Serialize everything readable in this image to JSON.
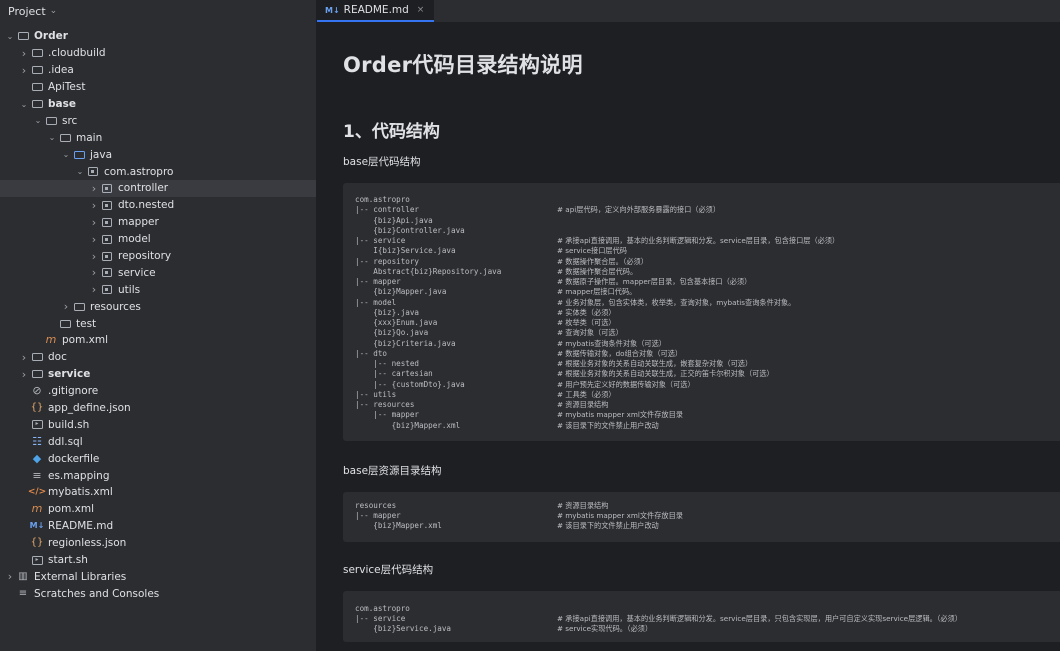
{
  "project_pane": {
    "title": "Project"
  },
  "tree": [
    {
      "label": "Order",
      "depth": 0,
      "arrow": "open",
      "icon": "folder-module",
      "bold": true
    },
    {
      "label": ".cloudbuild",
      "depth": 1,
      "arrow": "closed",
      "icon": "folder"
    },
    {
      "label": ".idea",
      "depth": 1,
      "arrow": "closed",
      "icon": "folder"
    },
    {
      "label": "ApiTest",
      "depth": 1,
      "arrow": "none",
      "icon": "folder"
    },
    {
      "label": "base",
      "depth": 1,
      "arrow": "open",
      "icon": "folder-module",
      "bold": true
    },
    {
      "label": "src",
      "depth": 2,
      "arrow": "open",
      "icon": "folder"
    },
    {
      "label": "main",
      "depth": 3,
      "arrow": "open",
      "icon": "folder"
    },
    {
      "label": "java",
      "depth": 4,
      "arrow": "open",
      "icon": "folder-blue"
    },
    {
      "label": "com.astropro",
      "depth": 5,
      "arrow": "open",
      "icon": "package"
    },
    {
      "label": "controller",
      "depth": 6,
      "arrow": "closed",
      "icon": "package",
      "selected": true
    },
    {
      "label": "dto.nested",
      "depth": 6,
      "arrow": "closed",
      "icon": "package"
    },
    {
      "label": "mapper",
      "depth": 6,
      "arrow": "closed",
      "icon": "package"
    },
    {
      "label": "model",
      "depth": 6,
      "arrow": "closed",
      "icon": "package"
    },
    {
      "label": "repository",
      "depth": 6,
      "arrow": "closed",
      "icon": "package"
    },
    {
      "label": "service",
      "depth": 6,
      "arrow": "closed",
      "icon": "package"
    },
    {
      "label": "utils",
      "depth": 6,
      "arrow": "closed",
      "icon": "package"
    },
    {
      "label": "resources",
      "depth": 4,
      "arrow": "closed",
      "icon": "folder-resources"
    },
    {
      "label": "test",
      "depth": 3,
      "arrow": "none",
      "icon": "folder"
    },
    {
      "label": "pom.xml",
      "depth": 2,
      "arrow": "none",
      "icon": "maven"
    },
    {
      "label": "doc",
      "depth": 1,
      "arrow": "closed",
      "icon": "folder"
    },
    {
      "label": "service",
      "depth": 1,
      "arrow": "closed",
      "icon": "folder-module",
      "bold": true
    },
    {
      "label": ".gitignore",
      "depth": 1,
      "arrow": "none",
      "icon": "gitignore"
    },
    {
      "label": "app_define.json",
      "depth": 1,
      "arrow": "none",
      "icon": "json"
    },
    {
      "label": "build.sh",
      "depth": 1,
      "arrow": "none",
      "icon": "shell"
    },
    {
      "label": "ddl.sql",
      "depth": 1,
      "arrow": "none",
      "icon": "sql"
    },
    {
      "label": "dockerfile",
      "depth": 1,
      "arrow": "none",
      "icon": "docker"
    },
    {
      "label": "es.mapping",
      "depth": 1,
      "arrow": "none",
      "icon": "text"
    },
    {
      "label": "mybatis.xml",
      "depth": 1,
      "arrow": "none",
      "icon": "xml"
    },
    {
      "label": "pom.xml",
      "depth": 1,
      "arrow": "none",
      "icon": "maven"
    },
    {
      "label": "README.md",
      "depth": 1,
      "arrow": "none",
      "icon": "markdown"
    },
    {
      "label": "regionless.json",
      "depth": 1,
      "arrow": "none",
      "icon": "json"
    },
    {
      "label": "start.sh",
      "depth": 1,
      "arrow": "none",
      "icon": "shell"
    },
    {
      "label": "External Libraries",
      "depth": 0,
      "arrow": "closed",
      "icon": "libraries"
    },
    {
      "label": "Scratches and Consoles",
      "depth": 0,
      "arrow": "none",
      "icon": "scratches"
    }
  ],
  "editor": {
    "tab": {
      "badge": "M↓",
      "label": "README.md",
      "close": "×"
    },
    "h1": "Order代码目录结构说明",
    "h2": "1、代码结构",
    "sections": [
      {
        "caption": "base层代码结构",
        "lines": [
          {
            "code": "com.astropro",
            "comment": ""
          },
          {
            "code": "|-- controller",
            "comment": "# api层代码，定义向外部服务暴露的接口（必须）"
          },
          {
            "code": "    {biz}Api.java",
            "comment": ""
          },
          {
            "code": "    {biz}Controller.java",
            "comment": ""
          },
          {
            "code": "|-- service",
            "comment": "# 承接api直接调用，基本的业务判断逻辑和分发。service层目录，包含接口层（必须）"
          },
          {
            "code": "    I{biz}Service.java",
            "comment": "# service接口层代码"
          },
          {
            "code": "|-- repository",
            "comment": "# 数据操作聚合层。（必须）"
          },
          {
            "code": "    Abstract{biz}Repository.java",
            "comment": "# 数据操作聚合层代码。"
          },
          {
            "code": "|-- mapper",
            "comment": "# 数据原子操作层。mapper层目录，包含基本接口（必须）"
          },
          {
            "code": "    {biz}Mapper.java",
            "comment": "# mapper层接口代码。"
          },
          {
            "code": "|-- model",
            "comment": "# 业务对象层，包含实体类，枚举类，查询对象，mybatis查询条件对象。"
          },
          {
            "code": "    {biz}.java",
            "comment": "# 实体类（必须）"
          },
          {
            "code": "    {xxx}Enum.java",
            "comment": "# 枚举类（可选）"
          },
          {
            "code": "    {biz}Qo.java",
            "comment": "# 查询对象（可选）"
          },
          {
            "code": "    {biz}Criteria.java",
            "comment": "# mybatis查询条件对象（可选）"
          },
          {
            "code": "|-- dto",
            "comment": "# 数据传输对象，do组合对象（可选）"
          },
          {
            "code": "    |-- nested",
            "comment": "# 根据业务对象的关系自动关联生成，嵌套复杂对象（可选）"
          },
          {
            "code": "    |-- cartesian",
            "comment": "# 根据业务对象的关系自动关联生成，正交的笛卡尔积对象（可选）"
          },
          {
            "code": "    |-- {customDto}.java",
            "comment": "# 用户预先定义好的数据传输对象（可选）"
          },
          {
            "code": "|-- utils",
            "comment": "# 工具类（必须）"
          },
          {
            "code": "|-- resources",
            "comment": "# 资源目录结构"
          },
          {
            "code": "    |-- mapper",
            "comment": "# mybatis mapper xml文件存放目录"
          },
          {
            "code": "        {biz}Mapper.xml",
            "comment": "# 该目录下的文件禁止用户改动"
          }
        ]
      },
      {
        "caption": "base层资源目录结构",
        "lines": [
          {
            "code": "resources",
            "comment": "# 资源目录结构"
          },
          {
            "code": "|-- mapper",
            "comment": "# mybatis mapper xml文件存放目录"
          },
          {
            "code": "    {biz}Mapper.xml",
            "comment": "# 该目录下的文件禁止用户改动"
          }
        ]
      },
      {
        "caption": "service层代码结构",
        "lines": [
          {
            "code": "com.astropro",
            "comment": ""
          },
          {
            "code": "|-- service",
            "comment": "# 承接api直接调用，基本的业务判断逻辑和分发。service层目录，只包含实现层，用户可自定义实现service层逻辑。（必须）"
          },
          {
            "code": "    {biz}Service.java",
            "comment": "# service实现代码。（必须）"
          }
        ]
      }
    ]
  }
}
